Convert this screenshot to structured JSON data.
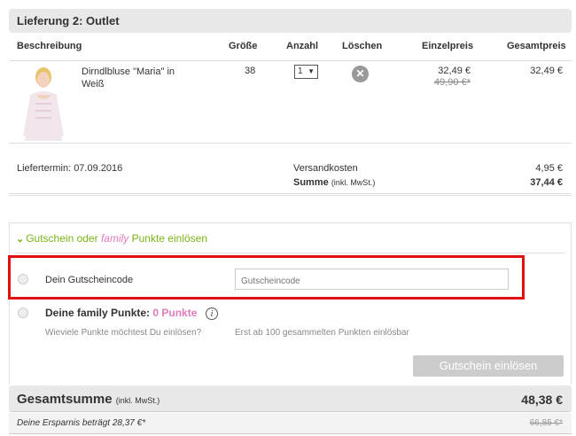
{
  "delivery": {
    "title": "Lieferung 2: Outlet"
  },
  "columns": {
    "description": "Beschreibung",
    "size": "Größe",
    "quantity": "Anzahl",
    "delete": "Löschen",
    "unit_price": "Einzelpreis",
    "total_price": "Gesamtpreis"
  },
  "item": {
    "name": "Dirndlbluse \"Maria\" in Weiß",
    "size": "38",
    "quantity": "1",
    "unit_price": "32,49 €",
    "old_price": "49,90 €*",
    "total_price": "32,49 €"
  },
  "summary": {
    "delivery_date": "Liefertermin: 07.09.2016",
    "shipping_label": "Versandkosten",
    "shipping_value": "4,95 €",
    "sum_label": "Summe",
    "sum_note": "(inkl. MwSt.)",
    "sum_value": "37,44 €"
  },
  "voucher": {
    "toggle_prefix": "Gutschein oder ",
    "toggle_family": "family",
    "toggle_suffix": " Punkte einlösen",
    "code_label": "Dein Gutscheincode",
    "code_placeholder": "Gutscheincode",
    "points_label": "Deine family Punkte: ",
    "points_value": "0 Punkte",
    "points_question": "Wieviele Punkte möchtest Du einlösen?",
    "points_note": "Erst ab 100 gesammelten Punkten einlösbar",
    "redeem_button": "Gutschein einlösen"
  },
  "totals": {
    "grand_label": "Gesamtsumme",
    "grand_note": "(inkl. MwSt.)",
    "grand_value": "48,38 €",
    "savings_label": "Deine Ersparnis beträgt 28,37 €*",
    "savings_value": "66,85 €*"
  },
  "colors": {
    "accent_green": "#7ab317",
    "family_pink": "#e07bbd",
    "highlight_red": "#e01010"
  }
}
